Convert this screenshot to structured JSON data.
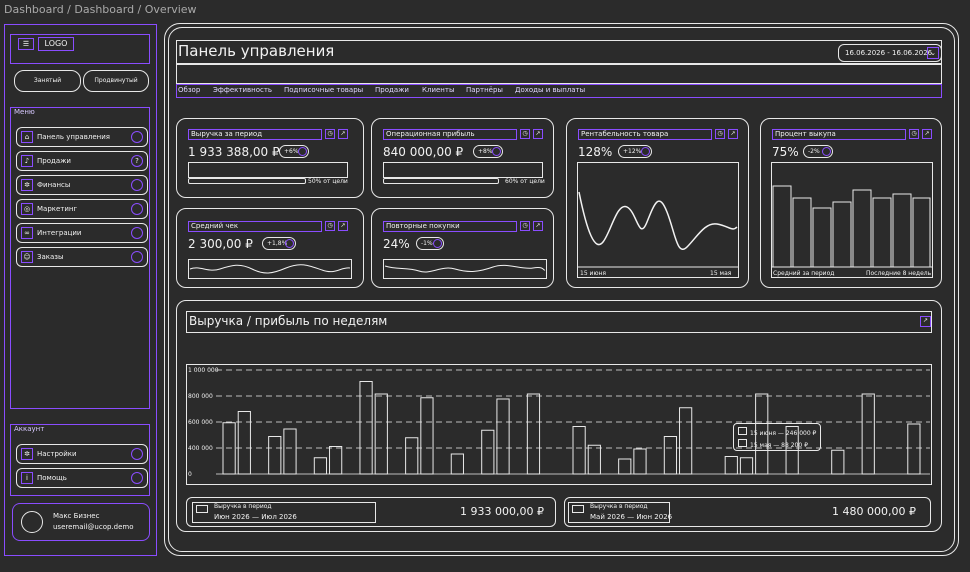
{
  "breadcrumb": "Dashboard / Dashboard / Overview",
  "sidebar": {
    "logo_mark": "☰",
    "logo_text": "LOGO",
    "seg": [
      "Занятый",
      "Продвинутый"
    ],
    "menu_label": "Меню",
    "menu": [
      {
        "label": "Панель управления",
        "icon": "home-icon"
      },
      {
        "label": "Продажи",
        "icon": "bell-icon",
        "badge": "?"
      },
      {
        "label": "Финансы",
        "icon": "gear-icon"
      },
      {
        "label": "Маркетинг",
        "icon": "target-icon"
      },
      {
        "label": "Интеграции",
        "icon": "link-icon"
      },
      {
        "label": "Заказы",
        "icon": "user-icon"
      }
    ],
    "account_label": "Аккаунт",
    "account": [
      {
        "label": "Настройки",
        "icon": "settings-icon"
      },
      {
        "label": "Помощь",
        "icon": "help-icon"
      }
    ],
    "profile": {
      "name": "Макс Бизнес",
      "email": "useremail@ucop.demo"
    }
  },
  "header": {
    "title": "Панель управления",
    "date_range": "16.06.2026 - 16.06.2026"
  },
  "tabs": [
    "Обзор",
    "Эффективность",
    "Подписочные товары",
    "Продажи",
    "Клиенты",
    "Партнёры",
    "Доходы и выплаты"
  ],
  "cards": {
    "revenue": {
      "title": "Выручка за период",
      "value": "1 933 388,00 ₽",
      "delta": "+6%",
      "note": "50% от цели"
    },
    "profit": {
      "title": "Операционная прибыль",
      "value": "840 000,00 ₽",
      "delta": "+8%",
      "note": "60% от цели"
    },
    "rentab": {
      "title": "Рентабельность товара",
      "value": "128%",
      "delta": "+12%",
      "from": "15 июня",
      "to": "15 мая"
    },
    "buyout": {
      "title": "Процент выкупа",
      "value": "75%",
      "delta": "-2%",
      "from": "Средний за период",
      "to": "Последние 8 недель"
    },
    "avgcheck": {
      "title": "Средний чек",
      "value": "2 300,00 ₽",
      "delta": "+1,8%"
    },
    "repeat": {
      "title": "Повторные покупки",
      "value": "24%",
      "delta": "-1%"
    }
  },
  "big_chart": {
    "title": "Выручка / прибыль по неделям",
    "tooltip": [
      "15 июня — 246 000 ₽",
      "15 мая — 88 200 ₽"
    ],
    "footer": [
      {
        "label": "Выручка в период",
        "range": "Июн 2026 — Июл 2026",
        "value": "1 933 000,00 ₽"
      },
      {
        "label": "Выручка в период",
        "range": "Май 2026 — Июн 2026",
        "value": "1 480 000,00 ₽"
      }
    ]
  },
  "chart_data": {
    "type": "bar",
    "yticks": [
      "1 000 000",
      "800 000",
      "600 000",
      "400 000",
      "0"
    ],
    "series": [
      {
        "values": [
          410,
          500,
          0,
          300,
          360,
          0,
          130,
          220,
          0,
          740,
          640,
          0,
          290,
          610,
          0,
          160,
          0,
          350,
          600,
          0,
          640,
          0,
          0,
          380,
          230,
          0,
          120,
          200,
          0,
          300,
          530,
          0,
          0,
          140,
          130,
          640,
          0,
          380,
          0,
          0,
          190,
          0,
          640,
          0,
          0,
          400
        ]
      }
    ],
    "ylim": [
      0,
      1000000
    ]
  }
}
